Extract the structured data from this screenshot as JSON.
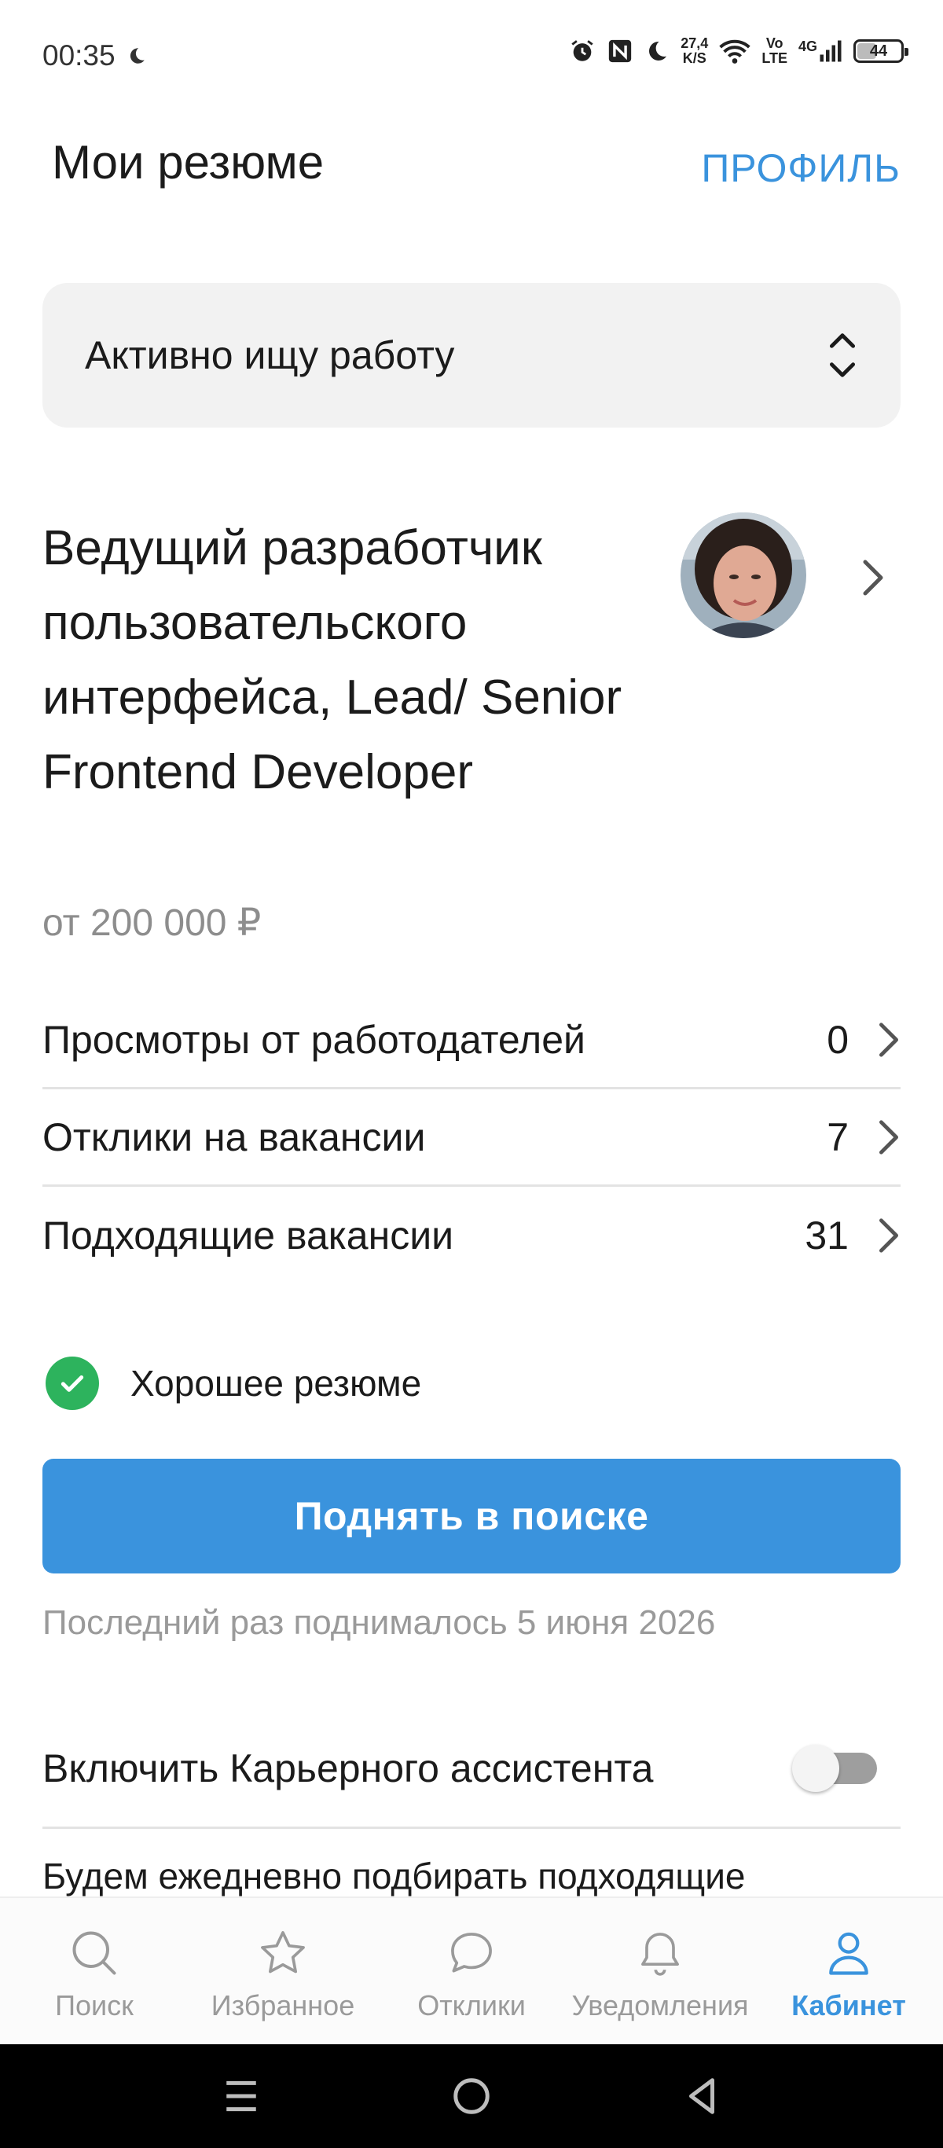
{
  "status_bar": {
    "time": "00:35",
    "net_speed_value": "27,4",
    "net_speed_unit": "K/S",
    "volte_top": "Vo",
    "volte_bottom": "LTE",
    "network": "4G",
    "battery": "44",
    "battery_level": 0.44
  },
  "header": {
    "title": "Мои резюме",
    "profile_link": "ПРОФИЛЬ"
  },
  "job_status": {
    "selected": "Активно ищу работу"
  },
  "resume": {
    "title": "Ведущий разработчик пользовательского интерфейса, Lead/ Senior Frontend Developer",
    "salary": "от 200 000 ₽",
    "stats": [
      {
        "label": "Просмотры от работодателей",
        "value": "0"
      },
      {
        "label": "Отклики на вакансии",
        "value": "7"
      },
      {
        "label": "Подходящие вакансии",
        "value": "31"
      }
    ],
    "quality_label": "Хорошее резюме",
    "raise_button": "Поднять в поиске",
    "last_raised": "Последний раз поднималось 5 июня 2026"
  },
  "assistant": {
    "label": "Включить Карьерного ассистента",
    "enabled": false,
    "teaser": "Будем ежедневно подбирать подходящие"
  },
  "tabs": [
    {
      "label": "Поиск",
      "icon": "search-icon",
      "active": false
    },
    {
      "label": "Избранное",
      "icon": "star-icon",
      "active": false
    },
    {
      "label": "Отклики",
      "icon": "chat-bubble-icon",
      "active": false
    },
    {
      "label": "Уведомления",
      "icon": "bell-icon",
      "active": false
    },
    {
      "label": "Кабинет",
      "icon": "person-icon",
      "active": true
    }
  ],
  "colors": {
    "accent": "#3a93dd",
    "success": "#2db35d",
    "muted_text": "#8d8d8d",
    "card_bg": "#f2f2f2"
  }
}
